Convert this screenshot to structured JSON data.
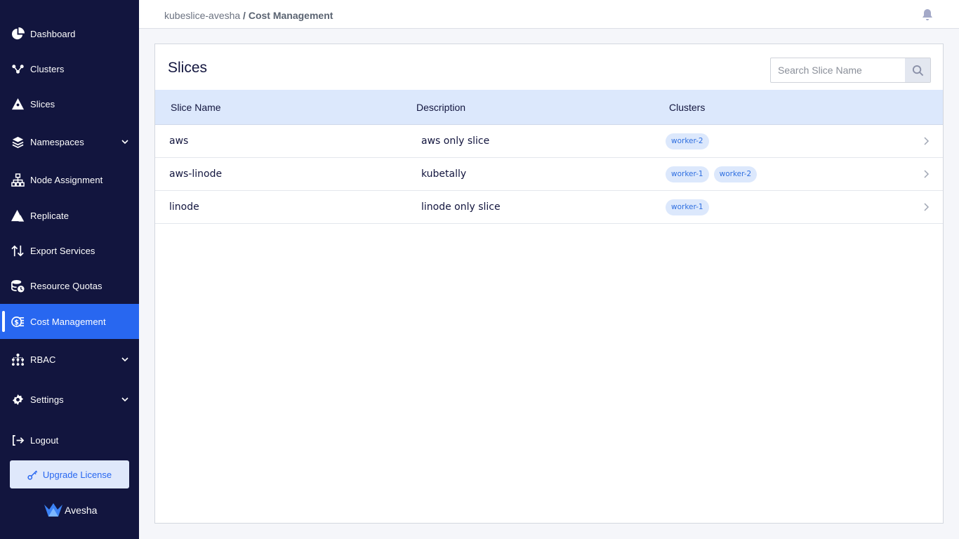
{
  "sidebar": {
    "items": [
      {
        "label": "Dashboard",
        "icon": "pie-chart-icon"
      },
      {
        "label": "Clusters",
        "icon": "cluster-nodes-icon"
      },
      {
        "label": "Slices",
        "icon": "slice-icon"
      },
      {
        "label": "Namespaces",
        "icon": "layers-icon",
        "expandable": true
      },
      {
        "label": "Node Assignment",
        "icon": "sitemap-icon"
      },
      {
        "label": "Replicate",
        "icon": "replicate-icon"
      },
      {
        "label": "Export Services",
        "icon": "arrows-up-down-icon"
      },
      {
        "label": "Resource Quotas",
        "icon": "database-clock-icon"
      },
      {
        "label": "Cost Management",
        "icon": "cost-coins-icon",
        "active": true
      },
      {
        "label": "RBAC",
        "icon": "rbac-tree-icon",
        "expandable": true
      },
      {
        "label": "Settings",
        "icon": "gear-icon",
        "expandable": true
      },
      {
        "label": "Logout",
        "icon": "logout-icon"
      }
    ],
    "upgrade_label": "Upgrade License",
    "brand_name": "Avesha"
  },
  "header": {
    "breadcrumb_project": "kubeslice-avesha",
    "breadcrumb_separator": " / ",
    "breadcrumb_current": "Cost Management"
  },
  "main": {
    "title": "Slices",
    "search_placeholder": "Search Slice Name",
    "columns": [
      "Slice Name",
      "Description",
      "Clusters"
    ],
    "rows": [
      {
        "name": "aws",
        "description": "aws only slice",
        "clusters": [
          "worker-2"
        ]
      },
      {
        "name": "aws-linode",
        "description": "kubetally",
        "clusters": [
          "worker-1",
          "worker-2"
        ]
      },
      {
        "name": "linode",
        "description": "linode only slice",
        "clusters": [
          "worker-1"
        ]
      }
    ]
  },
  "colors": {
    "sidebar_bg": "#12153e",
    "active_bg": "#2867f0",
    "header_row_bg": "#dce8fc",
    "chip_bg": "#dce8fc",
    "chip_text": "#2f6fe0"
  }
}
